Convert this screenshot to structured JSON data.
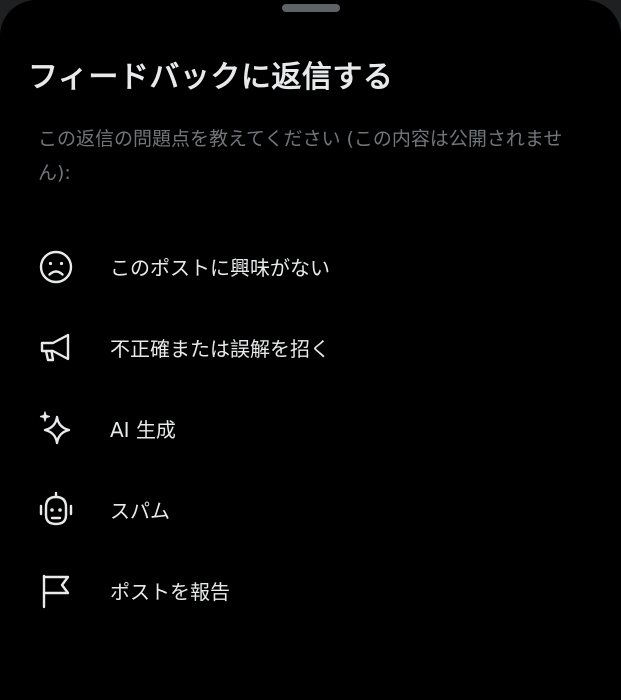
{
  "sheet": {
    "title": "フィードバックに返信する",
    "subtitle": "この返信の問題点を教えてください (この内容は公開されません):"
  },
  "options": [
    {
      "label": "このポストに興味がない",
      "icon": "frown-face-icon"
    },
    {
      "label": "不正確または誤解を招く",
      "icon": "megaphone-icon"
    },
    {
      "label": "AI 生成",
      "icon": "sparkle-icon"
    },
    {
      "label": "スパム",
      "icon": "robot-icon"
    },
    {
      "label": "ポストを報告",
      "icon": "flag-icon"
    }
  ],
  "colors": {
    "background": "#000000",
    "text_primary": "#e7e9ea",
    "text_secondary": "#71767b"
  }
}
